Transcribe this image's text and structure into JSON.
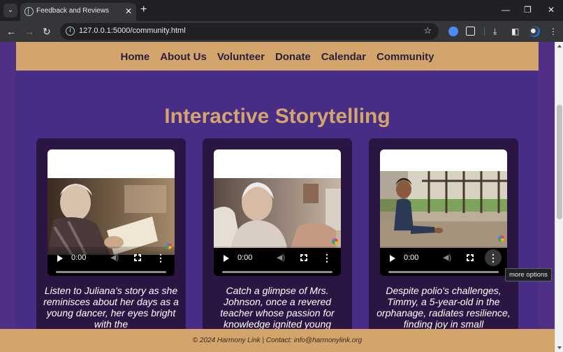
{
  "browser": {
    "tab_title": "Feedback and Reviews",
    "tab_close": "✕",
    "new_tab": "+",
    "url": "127.0.0.1:5000/community.html",
    "minimize": "—",
    "restore": "❐",
    "close": "✕"
  },
  "nav": {
    "items": [
      "Home",
      "About Us",
      "Volunteer",
      "Donate",
      "Calendar",
      "Community"
    ]
  },
  "main": {
    "heading": "Interactive Storytelling",
    "cards": [
      {
        "time": "0:00",
        "caption": "Listen to Juliana's story as she reminisces about her days as a young dancer, her eyes bright with the"
      },
      {
        "time": "0:00",
        "caption": "Catch a glimpse of Mrs. Johnson, once a revered teacher whose passion for knowledge ignited young"
      },
      {
        "time": "0:00",
        "caption": "Despite polio's challenges, Timmy, a 5-year-old in the orphanage, radiates resilience, finding joy in small"
      }
    ]
  },
  "tooltip": "more options",
  "footer": "© 2024 Harmony Link | Contact: info@harmonylink.org"
}
